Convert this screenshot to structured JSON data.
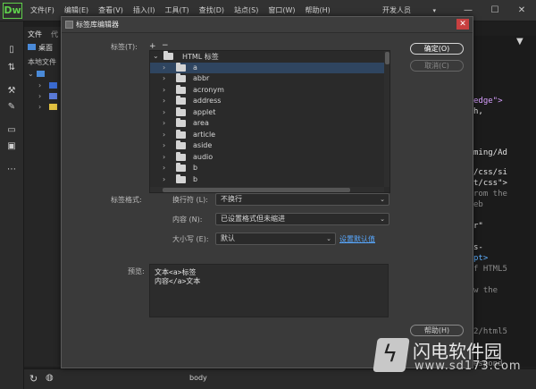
{
  "app": {
    "logo": "Dw",
    "accent": "#5fd14c"
  },
  "menubar": {
    "items": [
      "文件(F)",
      "编辑(E)",
      "查看(V)",
      "插入(I)",
      "工具(T)",
      "查找(D)",
      "站点(S)",
      "窗口(W)",
      "帮助(H)"
    ],
    "workspace": "开发人员",
    "min": "—",
    "max": "☐",
    "close": "✕"
  },
  "files_panel": {
    "tab_files": "文件",
    "tab_other": "代",
    "desktop": "桌面",
    "local": "本地文件"
  },
  "code_lines": [
    {
      "text": "edge\">",
      "color": "#d8a0ff"
    },
    {
      "text": "h,",
      "color": "#e0e0e0"
    },
    {
      "text": "ming/Ad",
      "color": "#e0e0e0"
    },
    {
      "text": "/css/si",
      "color": "#e0e0e0"
    },
    {
      "text": "t/css\">",
      "color": "#e0e0e0"
    },
    {
      "text": "rom the",
      "color": "#8a8a8a"
    },
    {
      "text": "eb",
      "color": "#8a8a8a"
    },
    {
      "text": "r\"",
      "color": "#e0e0e0"
    },
    {
      "text": "s-",
      "color": "#e0e0e0"
    },
    {
      "text": "pt>",
      "color": "#5fb0ff"
    },
    {
      "text": "f HTML5",
      "color": "#8a8a8a"
    },
    {
      "text": "w the",
      "color": "#8a8a8a"
    },
    {
      "text": "2/html5",
      "color": "#8a8a8a"
    },
    {
      "text": "espond",
      "color": "#8a8a8a"
    }
  ],
  "status": {
    "tag": "body"
  },
  "dialog": {
    "title": "标签库编辑器",
    "close": "✕",
    "tags_label": "标签(T):",
    "add": "+",
    "remove": "−",
    "tree_root": "HTML 标签",
    "tree_items": [
      "a",
      "abbr",
      "acronym",
      "address",
      "applet",
      "area",
      "article",
      "aside",
      "audio",
      "b",
      "b"
    ],
    "selected_index": 0,
    "ok": "确定(O)",
    "cancel": "取消(C)",
    "format_label": "标签格式:",
    "linebreak_label": "换行符 (L):",
    "linebreak_value": "不换行",
    "content_label": "内容 (N):",
    "content_value": "已设置格式但未缩进",
    "case_label": "大小写 (E):",
    "case_value": "默认",
    "set_default": "设置默认值",
    "preview_label": "预览:",
    "preview_line1": "文本<a>标签",
    "preview_line2": "内容</a>文本",
    "help": "帮助(H)"
  },
  "watermark": {
    "name": "闪电软件园",
    "url": "www.sd173.com"
  }
}
